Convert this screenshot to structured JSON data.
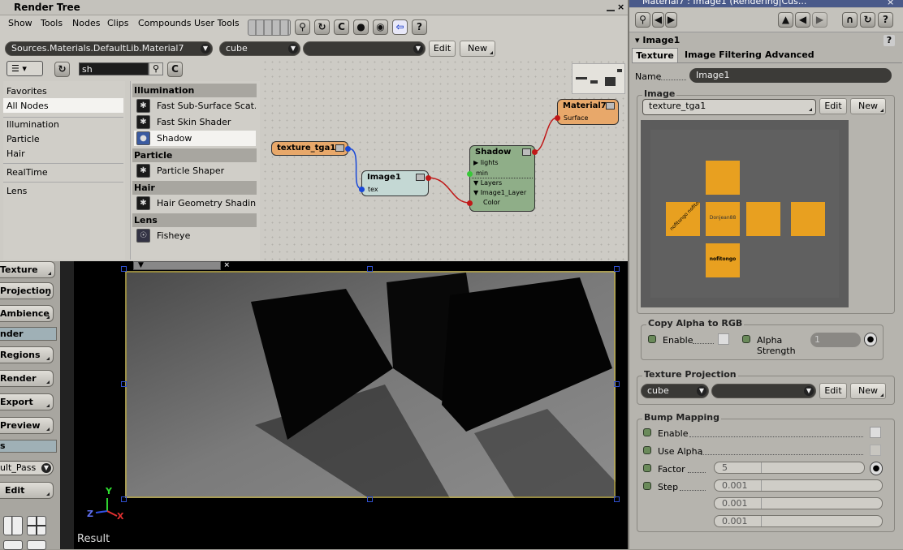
{
  "render_tree": {
    "title": "Render Tree",
    "menu": [
      "Show",
      "Tools",
      "Nodes",
      "Clips",
      "Compounds",
      "User Tools"
    ],
    "source_path": "Sources.Materials.DefaultLib.Material7",
    "projection_select": "cube",
    "empty_select": "",
    "edit_label": "Edit",
    "new_label": "New",
    "search_value": "sh",
    "categories": [
      "Favorites",
      "All Nodes",
      "Illumination",
      "Particle",
      "Hair",
      "RealTime",
      "Lens"
    ],
    "selected_category": "All Nodes",
    "sections": [
      {
        "title": "Illumination",
        "items": [
          "Fast Sub-Surface Scat...",
          "Fast Skin Shader",
          "Shadow"
        ]
      },
      {
        "title": "Particle",
        "items": [
          "Particle Shaper"
        ]
      },
      {
        "title": "Hair",
        "items": [
          "Hair Geometry Shading"
        ]
      },
      {
        "title": "Lens",
        "items": [
          "Fisheye"
        ]
      }
    ],
    "selected_item": "Shadow",
    "nodes": {
      "texture": {
        "title": "texture_tga1"
      },
      "image": {
        "title": "Image1",
        "port": "tex"
      },
      "shadow": {
        "title": "Shadow",
        "ports": [
          "▶ lights",
          "min",
          "▼ Layers",
          "▼ Image1_Layer",
          "Color"
        ]
      },
      "material": {
        "title": "Material7",
        "port": "Surface"
      }
    }
  },
  "left_toolbar": {
    "tabs": [
      "Texture",
      "Projection",
      "Ambience",
      "nder",
      "Regions",
      "Render",
      "Export",
      "Preview",
      "s"
    ],
    "selected_tabs": [
      "nder",
      "s"
    ],
    "pass_select": "ult_Pass",
    "edit_label": "Edit"
  },
  "viewport": {
    "label": "Result",
    "axis": {
      "y": "Y",
      "x": "X",
      "z": "Z"
    }
  },
  "ppg": {
    "title": "Material7 : Image1 (Rendering|Cus...",
    "section": "Image1",
    "tabs": [
      "Texture",
      "Image Filtering",
      "Advanced"
    ],
    "active_tab": "Texture",
    "name_label": "Name",
    "name_value": "Image1",
    "image_group": "Image",
    "image_select": "texture_tga1",
    "edit_label": "Edit",
    "new_label": "New",
    "preview_texts": [
      "Donjean88",
      "nofitongo",
      "nofitongo nofitongo"
    ],
    "copy_alpha": {
      "title": "Copy Alpha to RGB",
      "enable": "Enable",
      "alpha_strength": "Alpha Strength",
      "value": "1"
    },
    "texture_projection": {
      "title": "Texture Projection",
      "select": "cube",
      "empty_select": ""
    },
    "bump": {
      "title": "Bump Mapping",
      "enable": "Enable",
      "use_alpha": "Use Alpha",
      "factor": "Factor",
      "factor_value": "5",
      "step": "Step",
      "step_values": [
        "0.001",
        "0.001",
        "0.001"
      ]
    }
  },
  "colors": {
    "node_orange": "#e8a86a",
    "node_image": "#c4d8d4",
    "node_shadow": "#8fae88",
    "texture_orange": "#e8a020",
    "viewport_bg": "#000000"
  }
}
